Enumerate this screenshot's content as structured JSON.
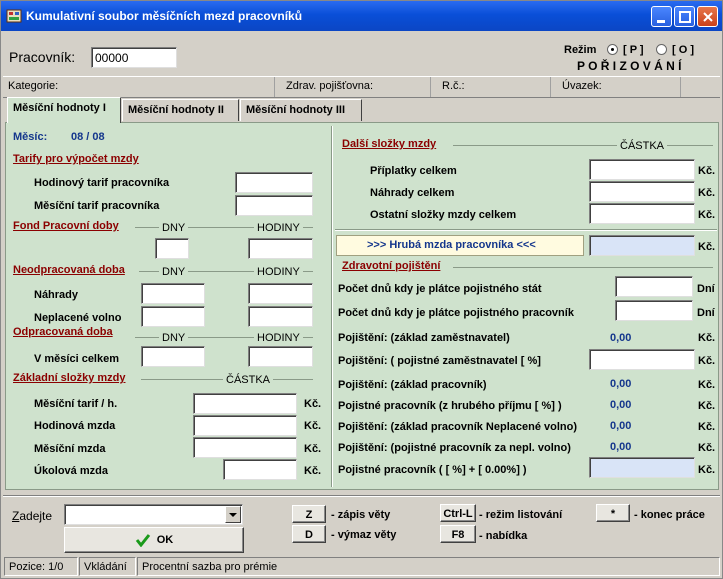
{
  "window": {
    "title": "Kumulativní soubor měsíčních mezd pracovníků"
  },
  "header": {
    "pracovnik_label": "Pracovník:",
    "pracovnik_value": "00000",
    "rezim_label": "Režim",
    "rezim_p": "[ P ]",
    "rezim_o": "[ O ]",
    "rezim_mode": "P O Ř I Z O V Á N Í"
  },
  "info_bar": {
    "kategorie": "Kategorie:",
    "zdrav": "Zdrav. pojišťovna:",
    "rc": "R.č.:",
    "uvazek": "Úvazek:"
  },
  "tabs": [
    {
      "label": "Měsíční hodnoty I"
    },
    {
      "label": "Měsíční hodnoty II"
    },
    {
      "label": "Měsíční hodnoty III"
    }
  ],
  "left": {
    "mesic_label": "Měsíc:",
    "mesic_value": "08 / 08",
    "tarify_title": "Tarify pro výpočet mzdy",
    "hodinovy_tarif": "Hodinový tarif pracovníka",
    "mesicni_tarif": "Měsíční tarif pracovníka",
    "fond_title": "Fond Pracovní doby",
    "dny": "DNY",
    "hodiny": "HODINY",
    "neodprac_title": "Neodpracovaná doba",
    "nahrady": "Náhrady",
    "neplacene": "Neplacené volno",
    "odprac_title": "Odpracovaná doba",
    "v_mesici": "V měsíci celkem",
    "zakladni_title": "Základní složky mzdy",
    "castka": "ČÁSTKA",
    "mesicni_tarif_h": "Měsíční tarif / h.",
    "hodinova_mzda": "Hodinová mzda",
    "mesicni_mzda": "Měsíční mzda",
    "ukolova_mzda": "Úkolová mzda",
    "kc": "Kč."
  },
  "right": {
    "dalsi_title": "Další složky mzdy",
    "castka": "ČÁSTKA",
    "priplatky": "Příplatky celkem",
    "nahrady": "Náhrady celkem",
    "ostatni": "Ostatní složky mzdy celkem",
    "hruba": ">>> Hrubá mzda pracovníka <<<",
    "zdrav_title": "Zdravotní pojištění",
    "pocet_stat": "Počet dnů kdy je plátce pojistného stát",
    "pocet_prac": "Počet dnů kdy je plátce pojistného pracovník",
    "dni": "Dní",
    "poj_zakl_zam": "Pojištění: (základ zaměstnavatel)",
    "poj_zakl_zam_val": "0,00",
    "poj_pojistne_zam": "Pojištění: ( pojistné zaměstnavatel [     %]",
    "poj_zakl_prac": "Pojištění: (základ pracovník)",
    "poj_zakl_prac_val": "0,00",
    "pojistne_prac": "Pojistné pracovník (z hrubého příjmu [     %] )",
    "pojistne_prac_val": "0,00",
    "poj_zakl_nepl": "Pojištění: (základ pracovník Neplacené volno)",
    "poj_zakl_nepl_val": "0,00",
    "poj_pojistne_nepl": "Pojištění: (pojistné pracovník za nepl. volno)",
    "poj_pojistne_nepl_val": "0,00",
    "pojistne_total": "Pojistné pracovník ( [     %] + [ 0.00%] )",
    "kc": "Kč."
  },
  "bottom": {
    "zadejte_prefix": "Z",
    "zadejte_rest": "adejte",
    "ok": "OK",
    "z_key": "Z",
    "z_desc": "- zápis věty",
    "d_key": "D",
    "d_desc": "- výmaz věty",
    "ctrll_key": "Ctrl-L",
    "ctrll_desc": "- režim listování",
    "f8_key": "F8",
    "f8_desc": "- nabídka",
    "star_key": "*",
    "star_desc": "- konec práce"
  },
  "status": {
    "pozice": "Pozice: 1/0",
    "vkladani": "Vkládání",
    "hint": "Procentní sazba pro prémie"
  },
  "colors": {
    "title_blue": "#0a4fd8",
    "panel_green": "#cfe2cd",
    "label_red": "#8b0000",
    "value_navy": "#14368c",
    "gross_blue": "#d9e4f7"
  }
}
